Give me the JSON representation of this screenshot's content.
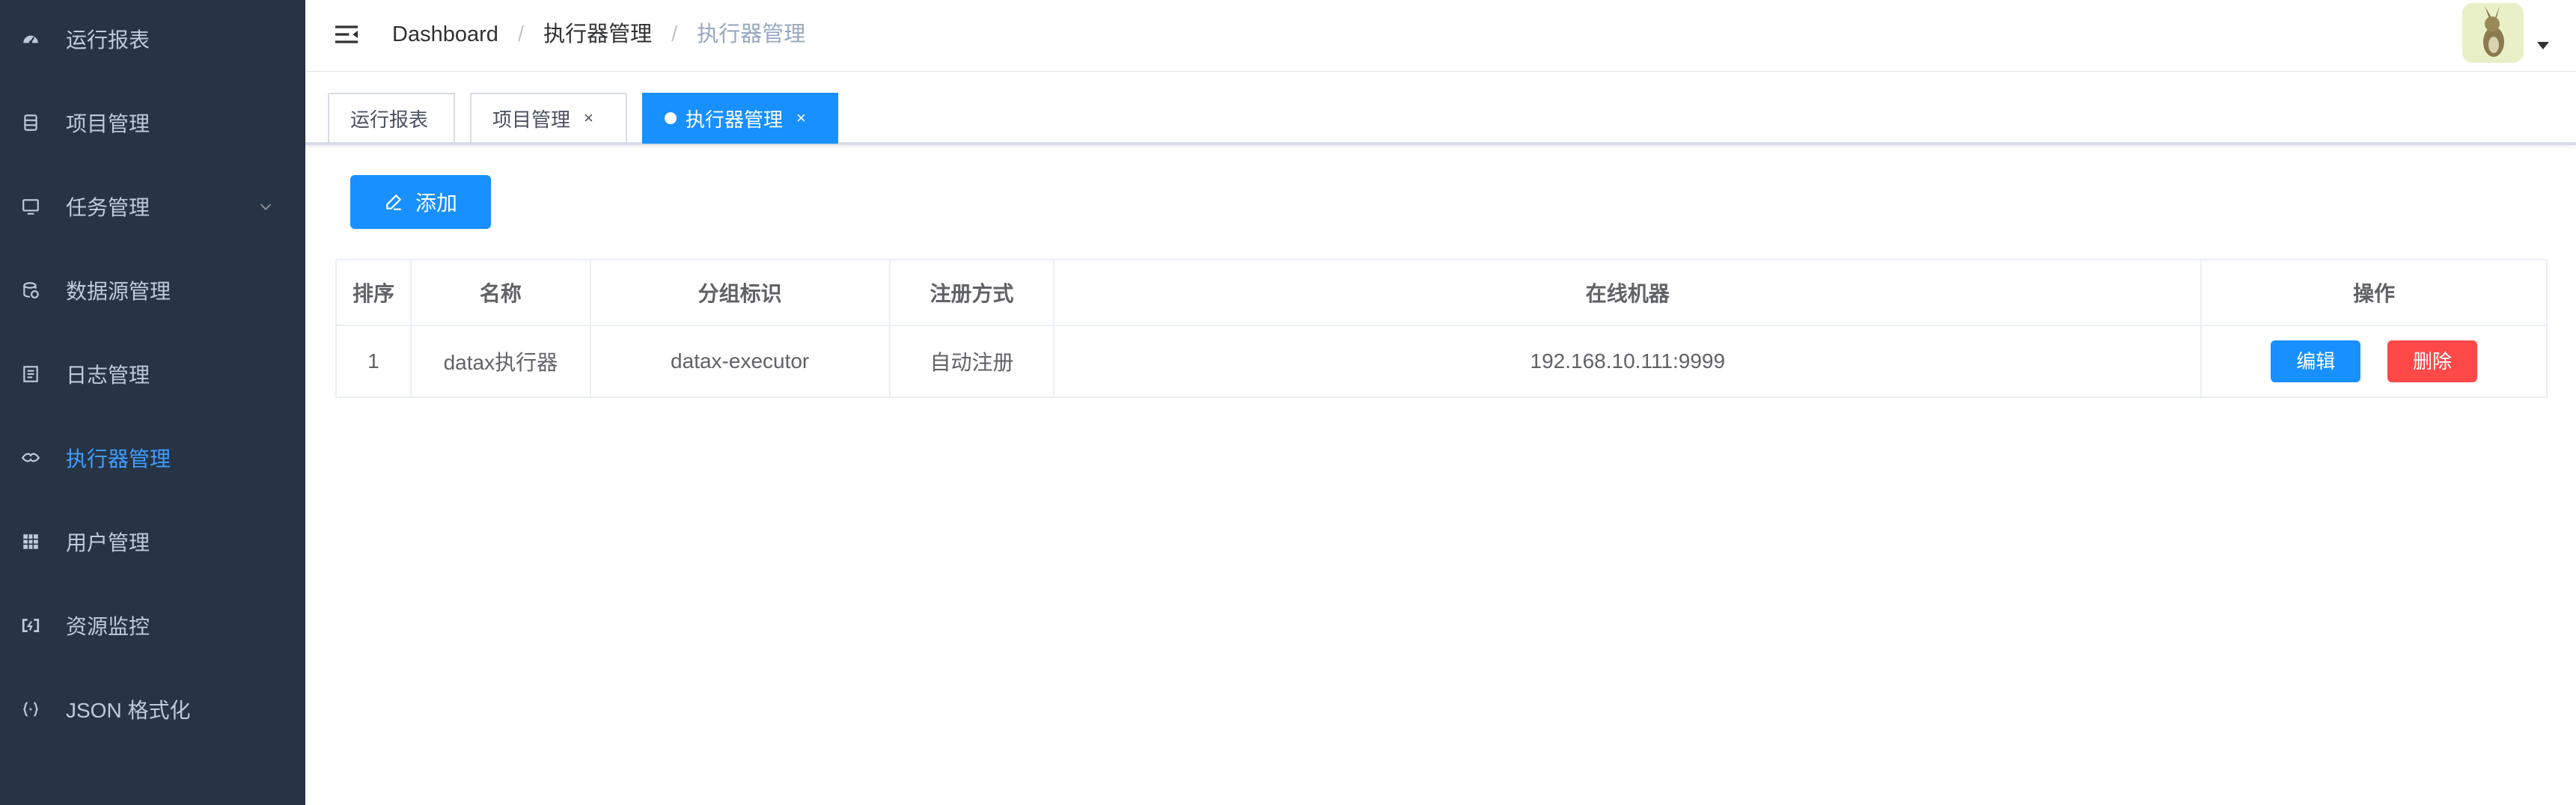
{
  "sidebar": {
    "items": [
      {
        "label": "运行报表",
        "icon": "dashboard-icon"
      },
      {
        "label": "项目管理",
        "icon": "project-icon"
      },
      {
        "label": "任务管理",
        "icon": "monitor-icon"
      },
      {
        "label": "数据源管理",
        "icon": "database-icon"
      },
      {
        "label": "日志管理",
        "icon": "log-icon"
      },
      {
        "label": "执行器管理",
        "icon": "executor-icon",
        "active": true
      },
      {
        "label": "用户管理",
        "icon": "table-grid-icon"
      },
      {
        "label": "资源监控",
        "icon": "resource-monitor-icon"
      },
      {
        "label": "JSON 格式化",
        "icon": "json-braces-icon"
      }
    ],
    "colors": {
      "background": "#263445",
      "text": "#bfcbd9",
      "active": "#409eff"
    }
  },
  "navbar": {
    "breadcrumb": [
      "Dashboard",
      "执行器管理",
      "执行器管理"
    ],
    "separator": "/"
  },
  "tags": [
    {
      "label": "运行报表",
      "closable": false,
      "active": false
    },
    {
      "label": "项目管理",
      "closable": true,
      "active": false
    },
    {
      "label": "执行器管理",
      "closable": true,
      "active": true
    }
  ],
  "tag_close": "×",
  "toolbar": {
    "add_label": "添加"
  },
  "table": {
    "headers": [
      "排序",
      "名称",
      "分组标识",
      "注册方式",
      "在线机器",
      "操作"
    ],
    "rows": [
      {
        "order": "1",
        "name": "datax执行器",
        "group": "datax-executor",
        "register": "自动注册",
        "address": "192.168.10.111:9999"
      }
    ],
    "edit_label": "编辑",
    "delete_label": "删除"
  },
  "colors": {
    "primary": "#1890ff",
    "danger": "#ff4949"
  }
}
